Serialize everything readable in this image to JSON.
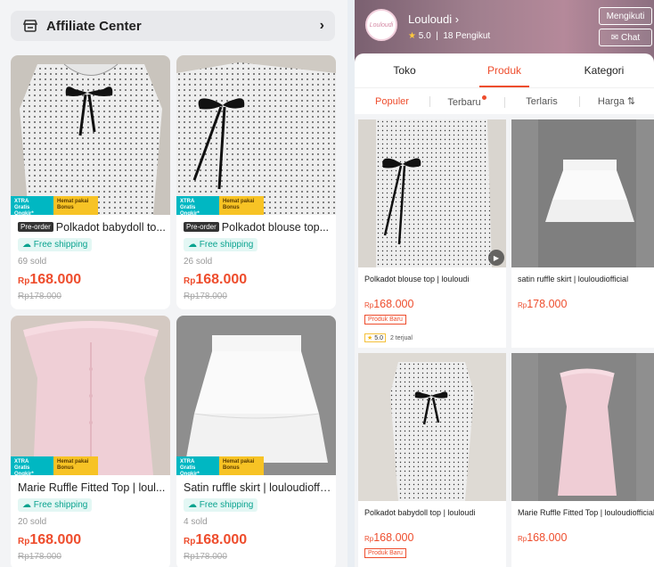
{
  "left": {
    "affiliate_title": "Affiliate Center",
    "badge_xtra_1": "XTRA",
    "badge_xtra_2": "Gratis Ongkir*",
    "badge_hemat_1": "Hemat pakai",
    "badge_hemat_2": "Bonus",
    "preorder": "Pre-order",
    "free_shipping": "Free shipping",
    "cards": [
      {
        "title": "Polkadot babydoll to...",
        "sold": "69 sold",
        "price_currency": "Rp",
        "price": "168.000",
        "original": "Rp178.000"
      },
      {
        "title": "Polkadot blouse top...",
        "sold": "26 sold",
        "price_currency": "Rp",
        "price": "168.000",
        "original": "Rp178.000"
      },
      {
        "title": "Marie Ruffle Fitted Top  | loul...",
        "sold": "20 sold",
        "price_currency": "Rp",
        "price": "168.000",
        "original": "Rp178.000"
      },
      {
        "title": "Satin ruffle skirt | louloudioffi...",
        "sold": "4 sold",
        "price_currency": "Rp",
        "price": "168.000",
        "original": "Rp178.000"
      }
    ]
  },
  "right": {
    "shop": {
      "name": "Louloudi",
      "rating": "5.0",
      "followers": "18 Pengikut",
      "follow_label": "Mengikuti",
      "chat_label": "Chat",
      "avatar_text": "Louloudi"
    },
    "tabs": [
      "Toko",
      "Produk",
      "Kategori"
    ],
    "sort": [
      "Populer",
      "Terbaru",
      "Terlaris",
      "Harga"
    ],
    "cards": [
      {
        "title": "Polkadot blouse top | louloudi",
        "price_currency": "Rp",
        "price": "168.000",
        "tag": "Produk Baru",
        "rating": "5.0",
        "sold": "2 terjual"
      },
      {
        "title": "satin ruffle skirt | louloudiofficial",
        "price_currency": "Rp",
        "price": "178.000"
      },
      {
        "title": "Polkadot babydoll top | louloudi",
        "price_currency": "Rp",
        "price": "168.000",
        "tag": "Produk Baru"
      },
      {
        "title": "Marie Ruffle Fitted Top | louloudiofficial",
        "price_currency": "Rp",
        "price": "168.000"
      }
    ]
  },
  "colors": {
    "accent": "#ee4d2d",
    "teal": "#00b7c2",
    "yellow": "#f7c325"
  }
}
